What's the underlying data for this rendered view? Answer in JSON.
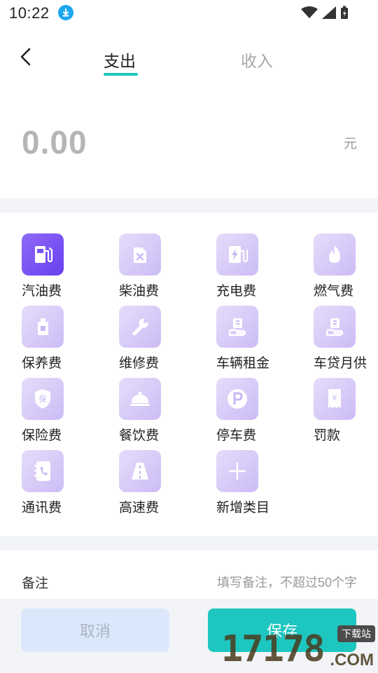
{
  "status_bar": {
    "time": "10:22"
  },
  "header": {
    "tabs": [
      {
        "label": "支出",
        "active": true
      },
      {
        "label": "收入",
        "active": false
      }
    ]
  },
  "amount": {
    "value": "0.00",
    "unit": "元"
  },
  "categories": [
    {
      "label": "汽油费",
      "icon": "gas-pump-icon",
      "selected": true
    },
    {
      "label": "柴油费",
      "icon": "fuel-can-icon"
    },
    {
      "label": "充电费",
      "icon": "charging-icon"
    },
    {
      "label": "燃气费",
      "icon": "flame-icon"
    },
    {
      "label": "保养费",
      "icon": "oil-bottle-icon"
    },
    {
      "label": "维修费",
      "icon": "wrench-icon"
    },
    {
      "label": "车辆租金",
      "icon": "hand-money-icon"
    },
    {
      "label": "车贷月供",
      "icon": "hand-money-icon"
    },
    {
      "label": "保险费",
      "icon": "shield-icon"
    },
    {
      "label": "餐饮费",
      "icon": "food-cloche-icon"
    },
    {
      "label": "停车费",
      "icon": "parking-icon"
    },
    {
      "label": "罚款",
      "icon": "receipt-icon"
    },
    {
      "label": "通讯费",
      "icon": "phone-book-icon"
    },
    {
      "label": "高速费",
      "icon": "highway-icon"
    },
    {
      "label": "新增类目",
      "icon": "plus-icon"
    }
  ],
  "remark": {
    "label": "备注",
    "placeholder": "填写备注，不超过50个字"
  },
  "buttons": {
    "cancel": "取消",
    "save": "保存"
  },
  "watermark": {
    "number": "17178",
    "domain": ".COM",
    "badge": "下载站"
  },
  "colors": {
    "accent": "#1ec6c0",
    "selected_icon": "#7b52f4",
    "icon_bg": "#d8ccf8"
  }
}
